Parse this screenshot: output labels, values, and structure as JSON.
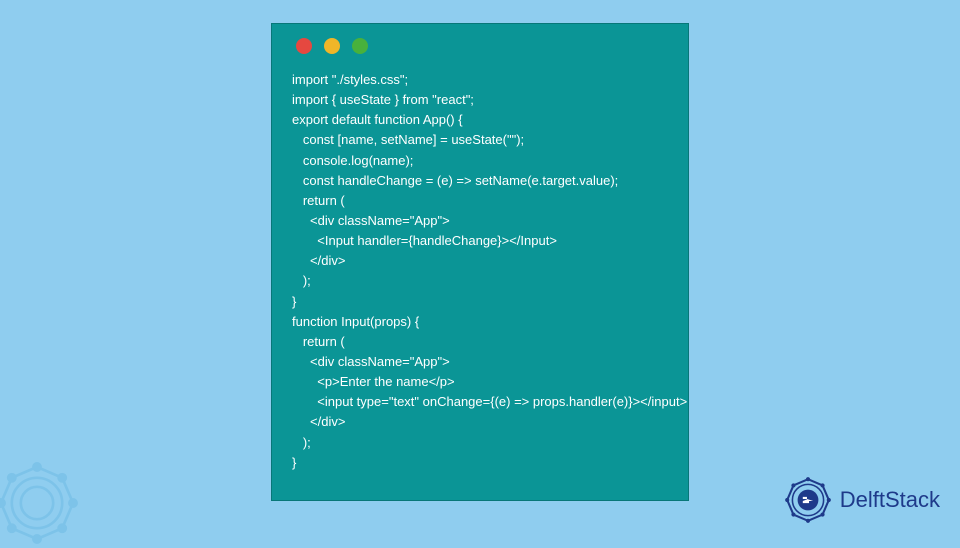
{
  "code": {
    "lines": [
      "import \"./styles.css\";",
      "import { useState } from \"react\";",
      "export default function App() {",
      "   const [name, setName] = useState(\"\");",
      "   console.log(name);",
      "   const handleChange = (e) => setName(e.target.value);",
      "   return (",
      "     <div className=\"App\">",
      "       <Input handler={handleChange}></Input>",
      "     </div>",
      "   );",
      "}",
      "function Input(props) {",
      "   return (",
      "     <div className=\"App\">",
      "       <p>Enter the name</p>",
      "       <input type=\"text\" onChange={(e) => props.handler(e)}></input>",
      "     </div>",
      "   );",
      "}"
    ]
  },
  "brand": {
    "name": "DelftStack"
  }
}
